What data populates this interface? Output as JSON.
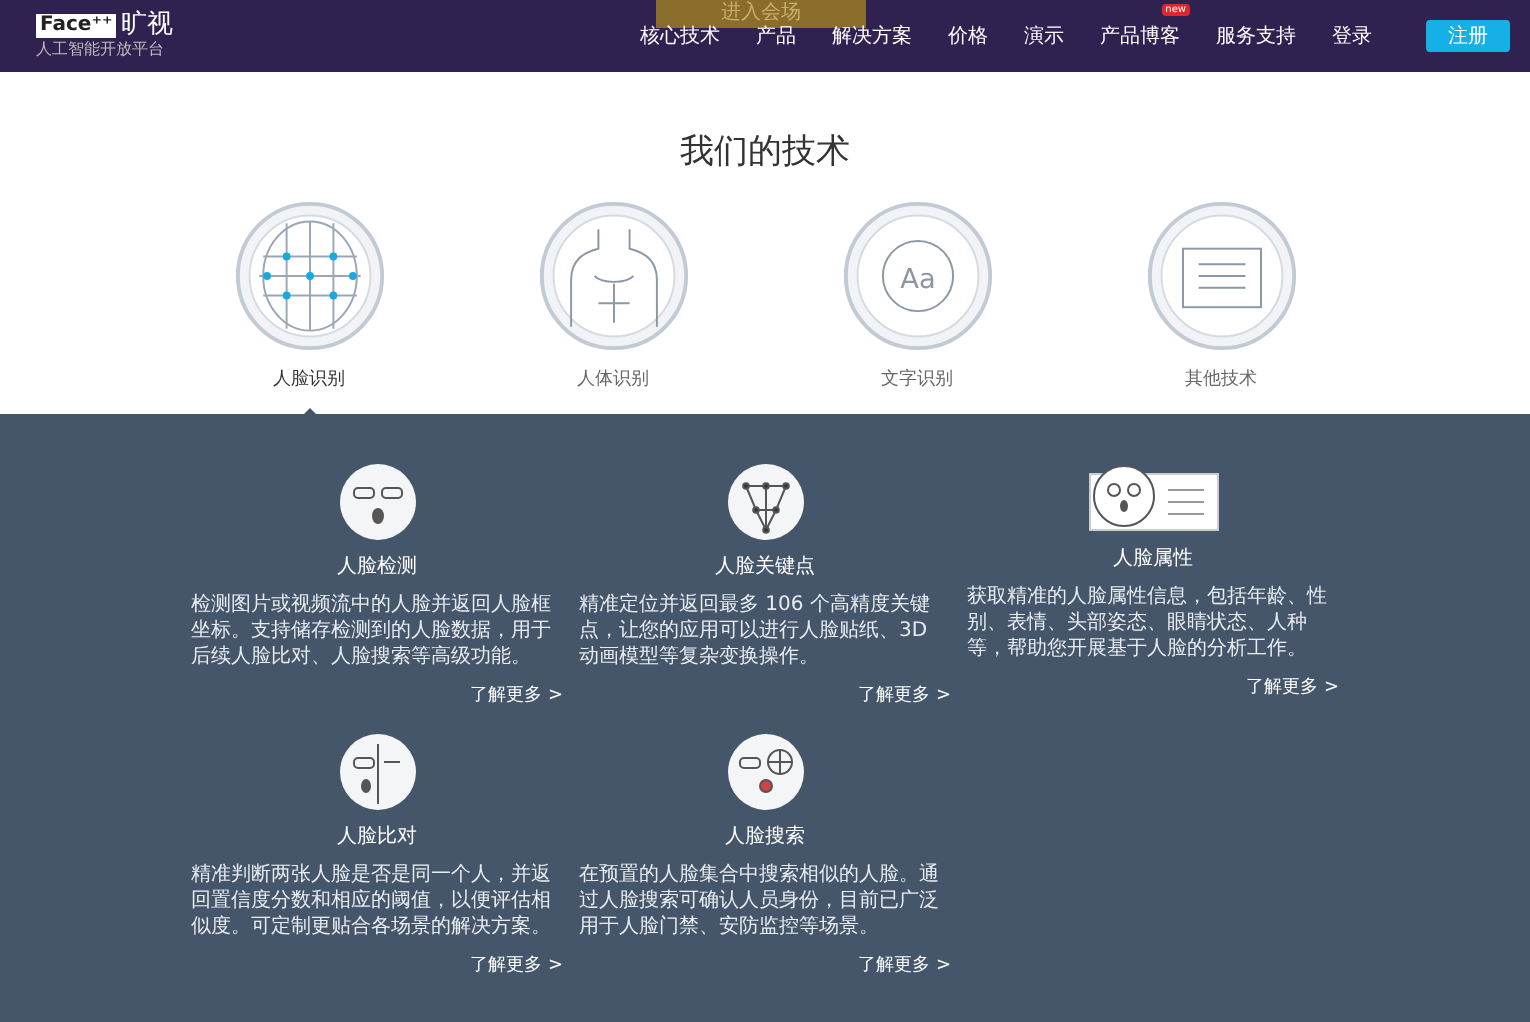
{
  "header": {
    "logo_mark": "Face⁺⁺",
    "logo_name": "旷视",
    "logo_tagline": "人工智能开放平台",
    "banner_button": "进入会场",
    "nav": [
      {
        "label": "核心技术"
      },
      {
        "label": "产品"
      },
      {
        "label": "解决方案"
      },
      {
        "label": "价格"
      },
      {
        "label": "演示"
      },
      {
        "label": "产品博客",
        "badge": "new"
      },
      {
        "label": "服务支持"
      },
      {
        "label": "登录"
      }
    ],
    "register_button": "注册"
  },
  "section_title": "我们的技术",
  "tech_tabs": [
    {
      "kind": "face",
      "label": "人脸识别",
      "selected": true
    },
    {
      "kind": "body",
      "label": "人体识别",
      "selected": false
    },
    {
      "kind": "text",
      "label": "文字识别",
      "selected": false,
      "icon_text": "Aa"
    },
    {
      "kind": "other",
      "label": "其他技术",
      "selected": false
    }
  ],
  "features": [
    {
      "kind": "detect",
      "title": "人脸检测",
      "description": "检测图片或视频流中的人脸并返回人脸框坐标。支持储存检测到的人脸数据，用于后续人脸比对、人脸搜索等高级功能。",
      "link": "了解更多 >"
    },
    {
      "kind": "landmark",
      "title": "人脸关键点",
      "description": "精准定位并返回最多 106 个高精度关键点，让您的应用可以进行人脸贴纸、3D 动画模型等复杂变换操作。",
      "link": "了解更多 >"
    },
    {
      "kind": "attribute",
      "title": "人脸属性",
      "description": "获取精准的人脸属性信息，包括年龄、性别、表情、头部姿态、眼睛状态、人种等，帮助您开展基于人脸的分析工作。",
      "link": "了解更多 >"
    },
    {
      "kind": "compare",
      "title": "人脸比对",
      "description": "精准判断两张人脸是否是同一个人，并返回置信度分数和相应的阈值，以便评估相似度。可定制更贴合各场景的解决方案。",
      "link": "了解更多 >"
    },
    {
      "kind": "search",
      "title": "人脸搜索",
      "description": "在预置的人脸集合中搜索相似的人脸。通过人脸搜索可确认人员身份，目前已广泛用于人脸门禁、安防监控等场景。",
      "link": "了解更多 >"
    }
  ]
}
